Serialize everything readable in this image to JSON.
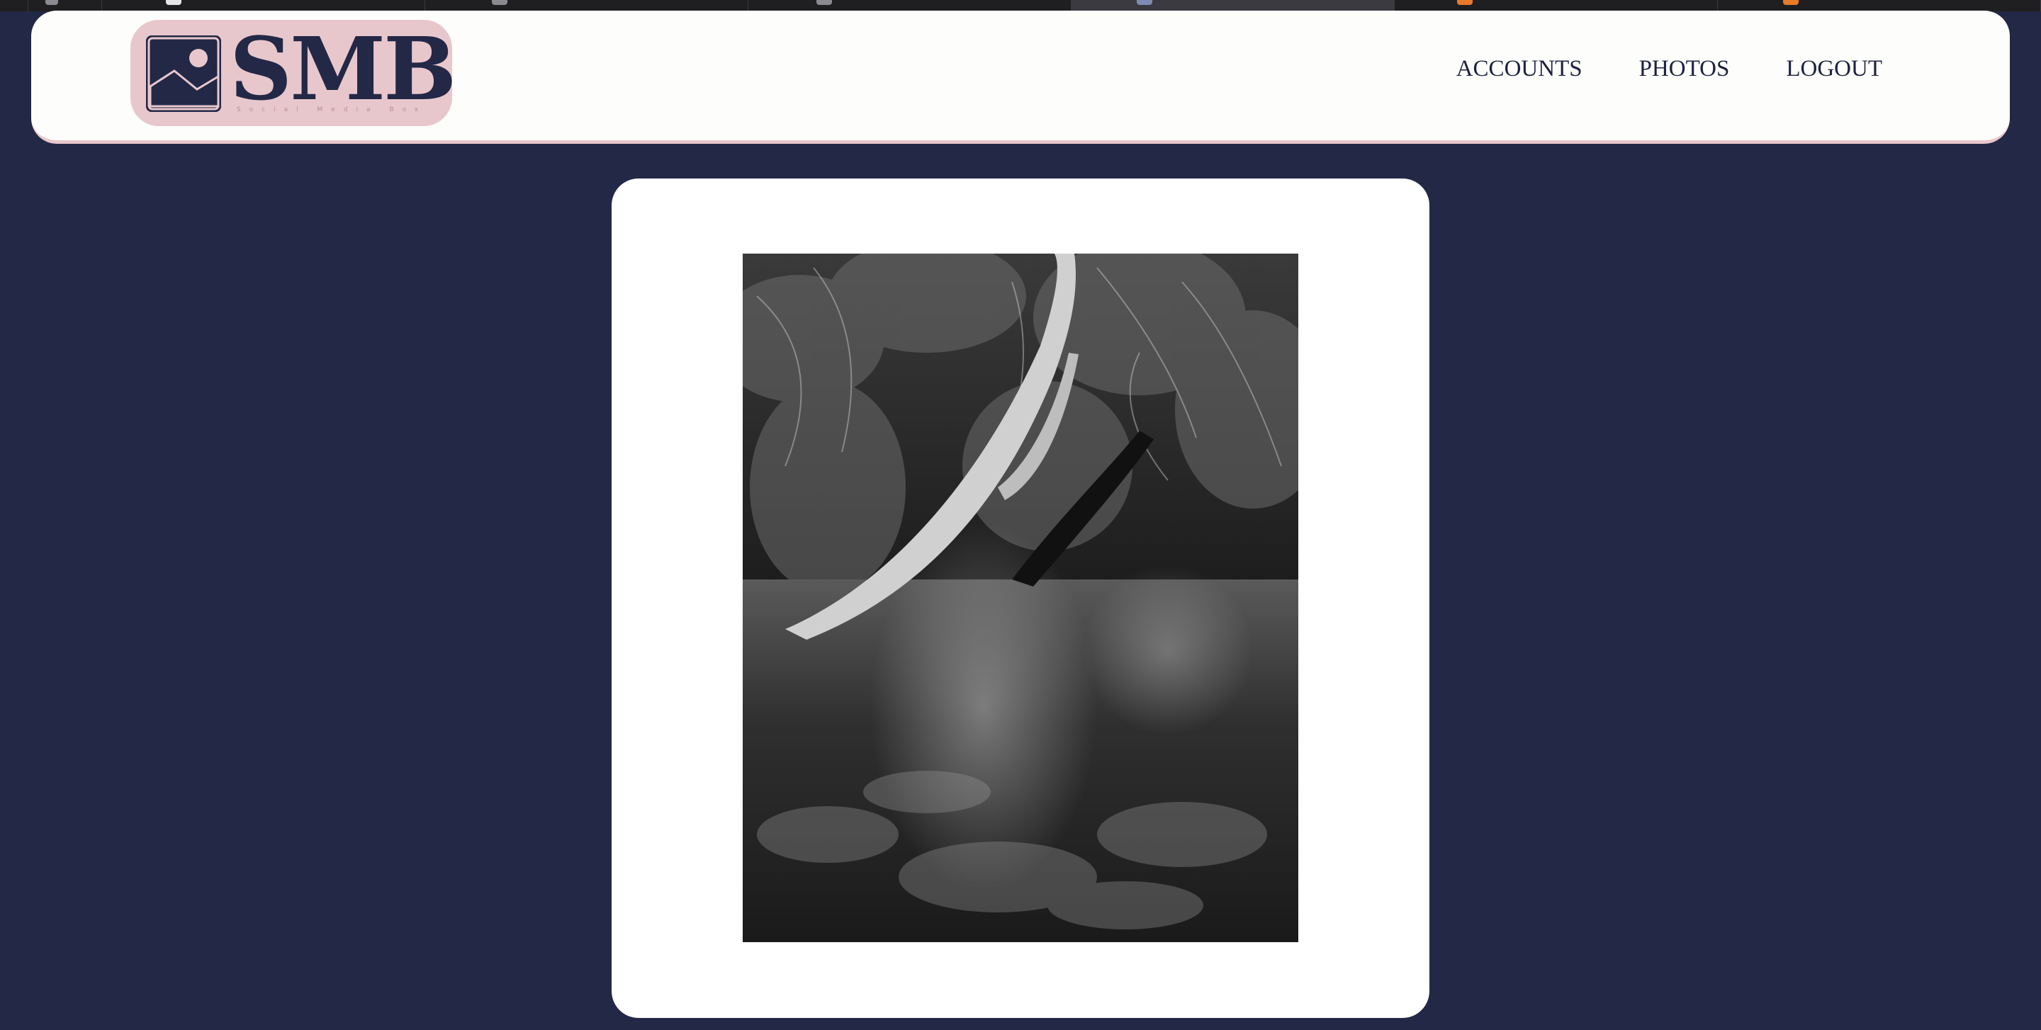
{
  "browser": {
    "tabs": [
      {
        "favicon": "generic-icon",
        "active": false
      },
      {
        "favicon": "facebook-icon",
        "active": false
      },
      {
        "favicon": "generic-icon",
        "active": false
      },
      {
        "favicon": "generic-icon",
        "active": false
      },
      {
        "favicon": "generic-icon",
        "active": true
      },
      {
        "favicon": "orange-icon",
        "active": false
      },
      {
        "favicon": "orange-icon",
        "active": false
      }
    ]
  },
  "header": {
    "logo": {
      "text": "SMB",
      "tagline": "Social Media Box",
      "icon": "image-icon",
      "background_color": "#e8c7cc"
    },
    "nav": {
      "accounts_label": "ACCOUNTS",
      "photos_label": "PHOTOS",
      "logout_label": "LOGOUT"
    }
  },
  "main": {
    "photo": {
      "subject": "black-and-white jungle river with leaning tree",
      "style": "grayscale"
    }
  },
  "colors": {
    "page_background": "#232846",
    "header_background": "#fdfdfb",
    "accent_pink": "#e8c7cc",
    "text_navy": "#1e2240"
  }
}
